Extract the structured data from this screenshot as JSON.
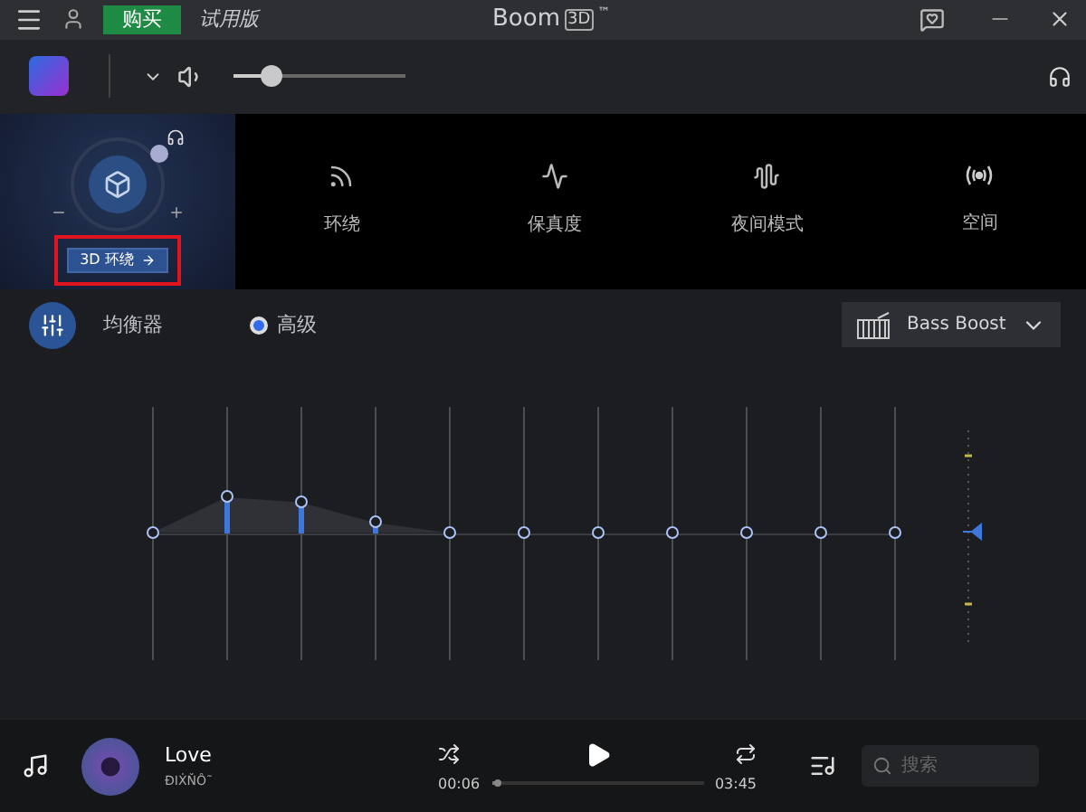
{
  "title_bar": {
    "buy_button": "购买",
    "trial_label": "试用版",
    "app_title": {
      "name": "Boom",
      "badge": "3D",
      "trademark": "™"
    }
  },
  "toolbar": {
    "volume": {
      "level": 0.22
    }
  },
  "effects": {
    "surround_button": "3D 环绕",
    "items": [
      {
        "kind": "ambience",
        "label": "环绕"
      },
      {
        "kind": "fidelity",
        "label": "保真度"
      },
      {
        "kind": "night",
        "label": "夜间模式"
      },
      {
        "kind": "spatial",
        "label": "空间"
      }
    ]
  },
  "equalizer": {
    "title": "均衡器",
    "mode": {
      "label": "高级",
      "selected": true
    },
    "preset": "Bass Boost",
    "bands": [
      {
        "level": 0.5
      },
      {
        "level": 0.64
      },
      {
        "level": 0.62
      },
      {
        "level": 0.54
      },
      {
        "level": 0.5
      },
      {
        "level": 0.5
      },
      {
        "level": 0.5
      },
      {
        "level": 0.5
      },
      {
        "level": 0.5
      },
      {
        "level": 0.5
      },
      {
        "level": 0.5
      }
    ]
  },
  "player": {
    "song": "Love",
    "artist": "ĐIẊŇÔ˜",
    "elapsed": "00:06",
    "progress": {
      "level": 0.03
    },
    "duration": "03:45",
    "search": {
      "placeholder": "搜索"
    }
  }
}
